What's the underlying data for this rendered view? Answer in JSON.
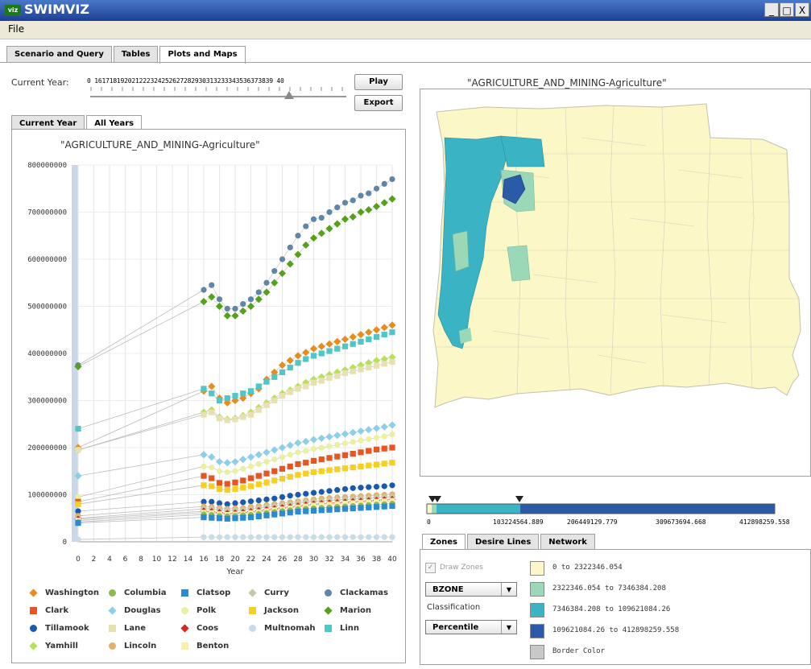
{
  "window": {
    "title": "SWIMVIZ",
    "icon_text": "viz",
    "minimize": "_",
    "maximize": "□",
    "close": "X"
  },
  "menu": {
    "file": "File"
  },
  "tabs": [
    "Scenario and Query",
    "Tables",
    "Plots and Maps"
  ],
  "year_control": {
    "label": "Current Year:",
    "ticks": "0 161718192021222324252627282930313233343536373839 40",
    "play": "Play",
    "export": "Export",
    "selected_year": 35
  },
  "left_tabs": [
    "Current Year",
    "All Years"
  ],
  "chart_data": {
    "type": "scatter",
    "title": "\"AGRICULTURE_AND_MINING-Agriculture\"",
    "xlabel": "Year",
    "ylabel": "",
    "xlim": [
      0,
      40
    ],
    "ylim": [
      0,
      800000000
    ],
    "x_ticks": [
      "0",
      "2",
      "4",
      "6",
      "8",
      "10",
      "12",
      "14",
      "16",
      "18",
      "20",
      "22",
      "24",
      "26",
      "28",
      "30",
      "32",
      "34",
      "36",
      "38",
      "40"
    ],
    "y_ticks": [
      "0",
      "100000000",
      "200000000",
      "300000000",
      "400000000",
      "500000000",
      "600000000",
      "700000000",
      "800000000"
    ],
    "x": [
      0,
      16,
      17,
      18,
      19,
      20,
      21,
      22,
      23,
      24,
      25,
      26,
      27,
      28,
      29,
      30,
      31,
      32,
      33,
      34,
      35,
      36,
      37,
      38,
      39,
      40
    ],
    "series": [
      {
        "name": "Clackamas",
        "color": "#5f86a8",
        "marker": "circle",
        "values": [
          375,
          535,
          545,
          515,
          495,
          495,
          505,
          515,
          530,
          550,
          575,
          600,
          625,
          650,
          670,
          685,
          688,
          700,
          710,
          720,
          725,
          735,
          740,
          750,
          760,
          770
        ]
      },
      {
        "name": "Marion",
        "color": "#55a11a",
        "marker": "diamond",
        "values": [
          372,
          510,
          520,
          500,
          480,
          480,
          490,
          500,
          515,
          530,
          550,
          570,
          590,
          610,
          630,
          645,
          655,
          665,
          675,
          685,
          690,
          700,
          705,
          712,
          720,
          728
        ]
      },
      {
        "name": "Washington",
        "color": "#e98c1c",
        "marker": "diamond",
        "values": [
          200,
          320,
          330,
          305,
          295,
          300,
          305,
          315,
          325,
          345,
          360,
          375,
          385,
          395,
          402,
          410,
          415,
          420,
          425,
          430,
          435,
          440,
          445,
          450,
          455,
          460
        ]
      },
      {
        "name": "Linn",
        "color": "#4fc7c7",
        "marker": "square",
        "values": [
          240,
          325,
          315,
          300,
          305,
          310,
          315,
          320,
          330,
          340,
          350,
          360,
          370,
          380,
          388,
          395,
          400,
          405,
          410,
          415,
          420,
          425,
          430,
          435,
          440,
          445
        ]
      },
      {
        "name": "Yamhill",
        "color": "#b8e05a",
        "marker": "diamond",
        "values": [
          195,
          275,
          280,
          265,
          260,
          262,
          268,
          275,
          285,
          295,
          305,
          315,
          322,
          330,
          338,
          345,
          350,
          355,
          360,
          365,
          370,
          375,
          380,
          385,
          388,
          392
        ]
      },
      {
        "name": "Lane",
        "color": "#e8e0b0",
        "marker": "square",
        "values": [
          195,
          270,
          275,
          262,
          258,
          260,
          265,
          270,
          280,
          290,
          300,
          310,
          318,
          325,
          330,
          338,
          342,
          348,
          352,
          358,
          362,
          366,
          370,
          374,
          378,
          382
        ]
      },
      {
        "name": "Douglas",
        "color": "#8ccfe8",
        "marker": "diamond",
        "values": [
          140,
          185,
          180,
          170,
          168,
          170,
          175,
          180,
          185,
          190,
          195,
          200,
          205,
          210,
          213,
          217,
          220,
          223,
          226,
          229,
          232,
          235,
          238,
          241,
          244,
          248
        ]
      },
      {
        "name": "Polk",
        "color": "#eaf0a0",
        "marker": "circle",
        "values": [
          95,
          160,
          158,
          150,
          148,
          150,
          155,
          160,
          165,
          170,
          175,
          180,
          185,
          190,
          193,
          197,
          200,
          203,
          206,
          209,
          212,
          215,
          218,
          221,
          224,
          228
        ]
      },
      {
        "name": "Clark",
        "color": "#e85520",
        "marker": "square",
        "values": [
          85,
          140,
          135,
          125,
          123,
          126,
          130,
          135,
          140,
          145,
          150,
          155,
          160,
          165,
          168,
          172,
          175,
          178,
          181,
          184,
          187,
          190,
          193,
          196,
          198,
          200
        ]
      },
      {
        "name": "Jackson",
        "color": "#f6d020",
        "marker": "square",
        "values": [
          80,
          120,
          118,
          112,
          110,
          112,
          115,
          118,
          122,
          126,
          130,
          134,
          138,
          142,
          145,
          148,
          150,
          152,
          154,
          156,
          158,
          160,
          162,
          164,
          166,
          168
        ]
      },
      {
        "name": "Tillamook",
        "color": "#1a5aaa",
        "marker": "circle",
        "values": [
          65,
          85,
          85,
          82,
          80,
          82,
          84,
          86,
          88,
          90,
          92,
          95,
          98,
          100,
          102,
          104,
          106,
          108,
          110,
          112,
          114,
          115,
          116,
          117,
          118,
          120
        ]
      },
      {
        "name": "Lincoln",
        "color": "#e2b06a",
        "marker": "circle",
        "values": [
          55,
          75,
          74,
          72,
          70,
          71,
          72,
          74,
          76,
          78,
          80,
          82,
          84,
          86,
          88,
          90,
          92,
          93,
          94,
          95,
          96,
          97,
          98,
          99,
          100,
          101
        ]
      },
      {
        "name": "Curry",
        "color": "#c8c8a8",
        "marker": "diamond",
        "values": [
          50,
          70,
          70,
          68,
          66,
          67,
          68,
          70,
          72,
          74,
          76,
          78,
          80,
          82,
          84,
          86,
          87,
          88,
          89,
          90,
          91,
          92,
          93,
          94,
          95,
          96
        ]
      },
      {
        "name": "Coos",
        "color": "#d2281e",
        "marker": "diamond",
        "values": [
          48,
          65,
          64,
          62,
          60,
          61,
          62,
          64,
          66,
          68,
          70,
          72,
          74,
          76,
          78,
          80,
          81,
          82,
          83,
          84,
          85,
          86,
          87,
          88,
          89,
          90
        ]
      },
      {
        "name": "Benton",
        "color": "#f6f0a8",
        "marker": "square",
        "values": [
          45,
          62,
          61,
          59,
          57,
          58,
          59,
          61,
          63,
          65,
          67,
          69,
          71,
          73,
          75,
          77,
          78,
          79,
          80,
          81,
          82,
          83,
          84,
          85,
          86,
          87
        ]
      },
      {
        "name": "Columbia",
        "color": "#90b850",
        "marker": "circle",
        "values": [
          42,
          58,
          57,
          55,
          54,
          55,
          56,
          57,
          59,
          61,
          63,
          65,
          67,
          69,
          70,
          71,
          72,
          73,
          74,
          75,
          76,
          77,
          78,
          79,
          80,
          81
        ]
      },
      {
        "name": "Clatsop",
        "color": "#2a8ad2",
        "marker": "square",
        "values": [
          40,
          52,
          51,
          50,
          49,
          50,
          51,
          52,
          54,
          56,
          58,
          60,
          62,
          64,
          65,
          66,
          67,
          68,
          69,
          70,
          71,
          72,
          73,
          74,
          75,
          76
        ]
      },
      {
        "name": "Multnomah",
        "color": "#c8dce8",
        "marker": "circle",
        "values": [
          5,
          10,
          10,
          10,
          10,
          10,
          10,
          10,
          10,
          10,
          10,
          10,
          10,
          10,
          10,
          10,
          10,
          10,
          10,
          10,
          10,
          10,
          10,
          10,
          10,
          10
        ]
      }
    ],
    "value_scale": 1000000,
    "legend_position": "bottom"
  },
  "legend_order": [
    [
      "Washington",
      "Columbia",
      "Clatsop",
      "Curry",
      "Clackamas"
    ],
    [
      "Clark",
      "Douglas",
      "Polk",
      "Jackson",
      "Marion"
    ],
    [
      "Tillamook",
      "Lane",
      "Coos",
      "Multnomah",
      "Linn"
    ],
    [
      "Yamhill",
      "Lincoln",
      "Benton"
    ]
  ],
  "map": {
    "title": "\"AGRICULTURE_AND_MINING-Agriculture\"",
    "scale_labels": [
      "0",
      "103224564.889",
      "206449129.779",
      "309673694.668",
      "412898259.558"
    ],
    "class_colors": [
      "#fbf7c6",
      "#9ad8b8",
      "#3ab4c4",
      "#2a5aa8"
    ]
  },
  "right_tabs": [
    "Zones",
    "Desire Lines",
    "Network"
  ],
  "zones_panel": {
    "draw_zones": "Draw Zones",
    "zone_type": "BZONE",
    "classification_label": "Classification",
    "classification": "Percentile",
    "classes": [
      {
        "label": "0 to 2322346.054",
        "color": "#fbf7c6"
      },
      {
        "label": "2322346.054 to 7346384.208",
        "color": "#9ad8b8"
      },
      {
        "label": "7346384.208 to 109621084.26",
        "color": "#3ab4c4"
      },
      {
        "label": "109621084.26 to 412898259.558",
        "color": "#2a5aa8"
      },
      {
        "label": "Border Color",
        "color": "#c8c8c8"
      }
    ]
  }
}
